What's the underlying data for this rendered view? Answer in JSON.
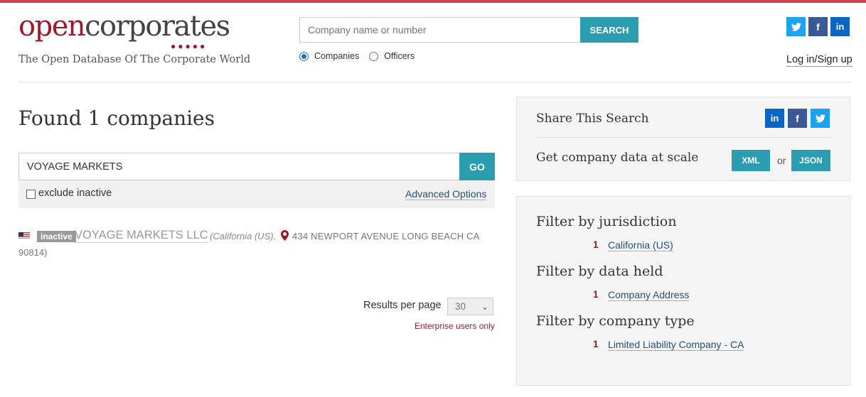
{
  "header": {
    "logo_open": "open",
    "logo_corp": "corporates",
    "tagline": "The Open Database Of The Corporate World",
    "search_placeholder": "Company name or number",
    "search_button": "SEARCH",
    "radio_companies": "Companies",
    "radio_officers": "Officers",
    "selected_radio": "Companies",
    "login": "Log in/Sign up"
  },
  "results": {
    "title": "Found 1 companies",
    "query": "VOYAGE MARKETS",
    "go_button": "GO",
    "exclude_inactive": "exclude inactive",
    "advanced": "Advanced Options",
    "items": [
      {
        "status": "inactive",
        "name": "VOYAGE MARKETS LLC",
        "jurisdiction": "(California (US),",
        "address": "434 NEWPORT AVENUE LONG BEACH CA",
        "address_cont": "90814)"
      }
    ],
    "per_page_label": "Results per page",
    "per_page_value": "30",
    "enterprise_note": "Enterprise users only"
  },
  "share": {
    "title": "Share This Search",
    "data_label": "Get company data at scale",
    "xml": "XML",
    "or": "or",
    "json": "JSON"
  },
  "filters": [
    {
      "title": "Filter by jurisdiction",
      "count": "1",
      "label": "California (US)"
    },
    {
      "title": "Filter by data held",
      "count": "1",
      "label": "Company Address"
    },
    {
      "title": "Filter by company type",
      "count": "1",
      "label": "Limited Liability Company - CA"
    }
  ],
  "colors": {
    "accent": "#2a9db1",
    "brand": "#9b1b2c",
    "twitter": "#1da1f2",
    "facebook": "#3b5998",
    "linkedin": "#0a66c2"
  }
}
